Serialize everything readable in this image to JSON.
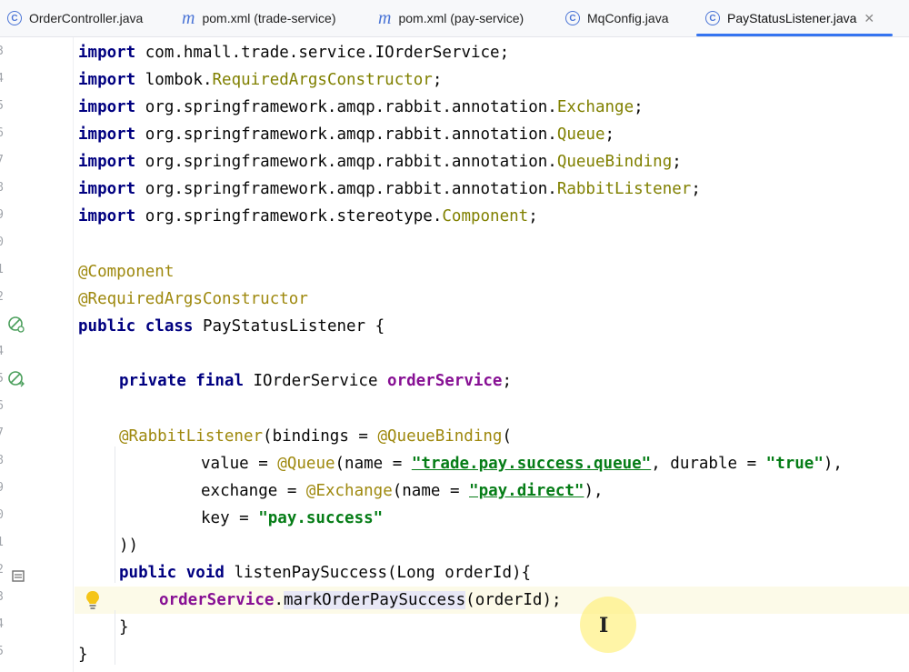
{
  "tabs": [
    {
      "label": "OrderController.java",
      "icon": "class-icon"
    },
    {
      "label": "pom.xml (trade-service)",
      "icon": "maven-icon"
    },
    {
      "label": "pom.xml (pay-service)",
      "icon": "maven-icon"
    },
    {
      "label": "MqConfig.java",
      "icon": "class-icon"
    },
    {
      "label": "PayStatusListener.java",
      "icon": "class-icon",
      "active": true
    }
  ],
  "editor": {
    "lines": {
      "l1": {
        "kw": "import",
        "a": " com.hmall.trade.service.IOrderService;"
      },
      "l2": {
        "kw": "import",
        "a": " lombok.",
        "b": "RequiredArgsConstructor",
        "c": ";"
      },
      "l3": {
        "kw": "import",
        "a": " org.springframework.amqp.rabbit.annotation.",
        "b": "Exchange",
        "c": ";"
      },
      "l4": {
        "kw": "import",
        "a": " org.springframework.amqp.rabbit.annotation.",
        "b": "Queue",
        "c": ";"
      },
      "l5": {
        "kw": "import",
        "a": " org.springframework.amqp.rabbit.annotation.",
        "b": "QueueBinding",
        "c": ";"
      },
      "l6": {
        "kw": "import",
        "a": " org.springframework.amqp.rabbit.annotation.",
        "b": "RabbitListener",
        "c": ";"
      },
      "l7": {
        "kw": "import",
        "a": " org.springframework.stereotype.",
        "b": "Component",
        "c": ";"
      },
      "l8": {
        "ann": "@Component"
      },
      "l9": {
        "ann": "@RequiredArgsConstructor"
      },
      "l10": {
        "kw1": "public",
        "kw2": " class",
        "a": " PayStatusListener {"
      },
      "l11": {
        "kw1": "private",
        "kw2": " final",
        "a": " IOrderService ",
        "field": "orderService",
        "c": ";"
      },
      "l12": {
        "ann": "@RabbitListener",
        "a": "(bindings = ",
        "ann2": "@QueueBinding",
        "c": "("
      },
      "l13": {
        "a": "value = ",
        "ann": "@Queue",
        "b": "(name = ",
        "str": "\"trade.pay.success.queue\"",
        "c": ", durable = ",
        "str2": "\"true\"",
        "d": "),"
      },
      "l14": {
        "a": "exchange = ",
        "ann": "@Exchange",
        "b": "(name = ",
        "str": "\"pay.direct\"",
        "c": "),"
      },
      "l15": {
        "a": "key = ",
        "str": "\"pay.success\""
      },
      "l16": {
        "a": "))"
      },
      "l17": {
        "kw1": "public",
        "kw2": " void",
        "a": " listenPaySuccess(Long orderId){"
      },
      "l18": {
        "field": "orderService",
        "a": ".",
        "meth": "markOrderPaySuccess",
        "c": "(orderId);"
      },
      "l19": {
        "a": "}"
      },
      "l20": {
        "a": "}"
      }
    },
    "gutter_numbers": [
      "3",
      "4",
      "5",
      "6",
      "7",
      "8",
      "9",
      "0",
      "1",
      "2",
      "3",
      "4",
      "5",
      "6",
      "7",
      "8",
      "9",
      "0",
      "1",
      "2",
      "3",
      "4",
      "5",
      "6"
    ]
  }
}
